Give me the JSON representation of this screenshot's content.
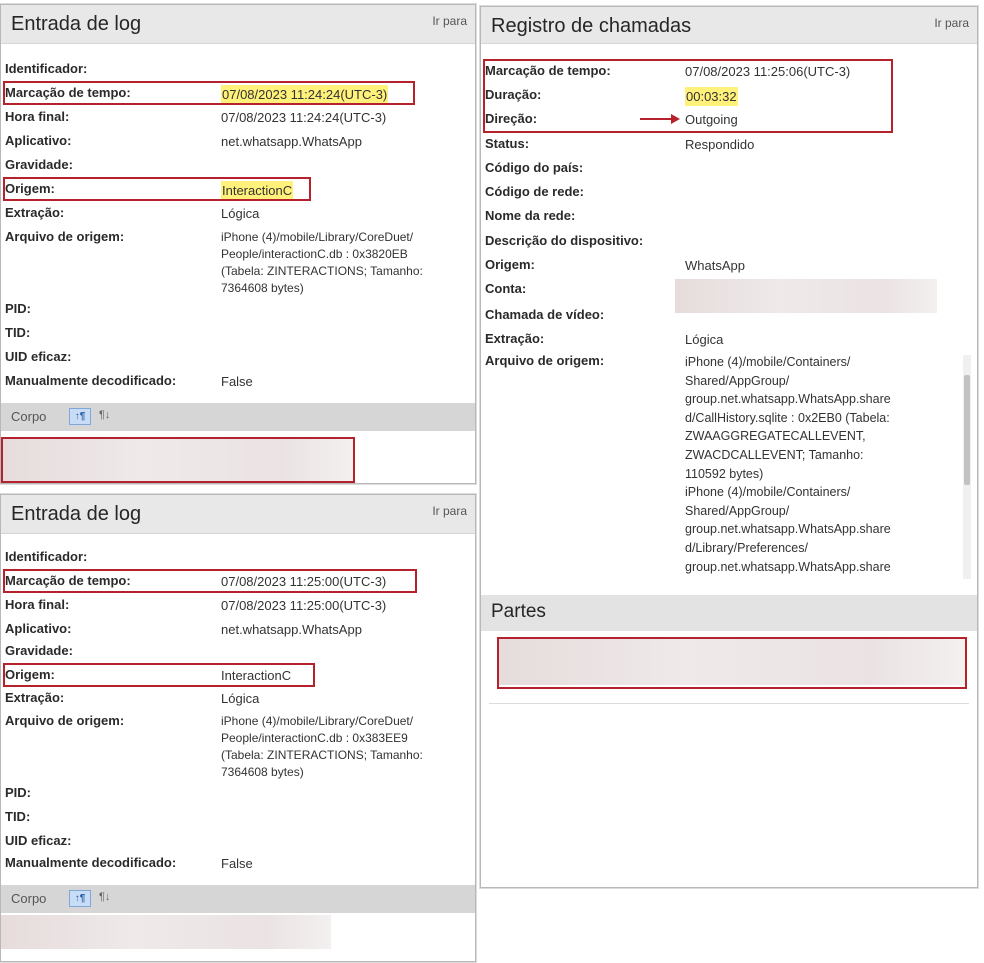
{
  "log1": {
    "title": "Entrada de log",
    "goto": "Ir para",
    "fields": {
      "identificador": {
        "label": "Identificador:",
        "value": ""
      },
      "marcacao": {
        "label": "Marcação de tempo:",
        "value": "07/08/2023 11:24:24(UTC-3)"
      },
      "hora_final": {
        "label": "Hora final:",
        "value": "07/08/2023 11:24:24(UTC-3)"
      },
      "aplicativo": {
        "label": "Aplicativo:",
        "value": "net.whatsapp.WhatsApp"
      },
      "gravidade": {
        "label": "Gravidade:",
        "value": ""
      },
      "origem": {
        "label": "Origem:",
        "value": "InteractionC"
      },
      "extracao": {
        "label": "Extração:",
        "value": "Lógica"
      },
      "arquivo": {
        "label": "Arquivo de origem:",
        "value_lines": [
          "iPhone (4)/mobile/Library/CoreDuet/",
          "People/interactionC.db : 0x3820EB",
          "(Tabela: ZINTERACTIONS; Tamanho:",
          "7364608 bytes)"
        ]
      },
      "pid": {
        "label": "PID:",
        "value": ""
      },
      "tid": {
        "label": "TID:",
        "value": ""
      },
      "uid": {
        "label": "UID eficaz:",
        "value": ""
      },
      "manual": {
        "label": "Manualmente decodificado:",
        "value": "False"
      }
    },
    "toolbar": {
      "corpo": "Corpo",
      "btn1": "↑¶",
      "btn2": "¶↓"
    }
  },
  "log2": {
    "title": "Entrada de log",
    "goto": "Ir para",
    "fields": {
      "identificador": {
        "label": "Identificador:",
        "value": ""
      },
      "marcacao": {
        "label": "Marcação de tempo:",
        "value": "07/08/2023 11:25:00(UTC-3)"
      },
      "hora_final": {
        "label": "Hora final:",
        "value": "07/08/2023 11:25:00(UTC-3)"
      },
      "aplicativo": {
        "label": "Aplicativo:",
        "value": "net.whatsapp.WhatsApp"
      },
      "gravidade": {
        "label": "Gravidade:",
        "value": ""
      },
      "origem": {
        "label": "Origem:",
        "value": "InteractionC"
      },
      "extracao": {
        "label": "Extração:",
        "value": "Lógica"
      },
      "arquivo": {
        "label": "Arquivo de origem:",
        "value_lines": [
          "iPhone (4)/mobile/Library/CoreDuet/",
          "People/interactionC.db : 0x383EE9",
          "(Tabela: ZINTERACTIONS; Tamanho:",
          "7364608 bytes)"
        ]
      },
      "pid": {
        "label": "PID:",
        "value": ""
      },
      "tid": {
        "label": "TID:",
        "value": ""
      },
      "uid": {
        "label": "UID eficaz:",
        "value": ""
      },
      "manual": {
        "label": "Manualmente decodificado:",
        "value": "False"
      }
    },
    "toolbar": {
      "corpo": "Corpo",
      "btn1": "↑¶",
      "btn2": "¶↓"
    }
  },
  "calls": {
    "title": "Registro de chamadas",
    "goto": "Ir para",
    "fields": {
      "marcacao": {
        "label": "Marcação de tempo:",
        "value": "07/08/2023 11:25:06(UTC-3)"
      },
      "duracao": {
        "label": "Duração:",
        "value": "00:03:32"
      },
      "direcao": {
        "label": "Direção:",
        "value": "Outgoing"
      },
      "status": {
        "label": "Status:",
        "value": "Respondido"
      },
      "codigo_pais": {
        "label": "Código do país:",
        "value": ""
      },
      "codigo_rede": {
        "label": "Código de rede:",
        "value": ""
      },
      "nome_rede": {
        "label": "Nome da rede:",
        "value": ""
      },
      "descricao": {
        "label": "Descrição do dispositivo:",
        "value": ""
      },
      "origem": {
        "label": "Origem:",
        "value": "WhatsApp"
      },
      "conta": {
        "label": "Conta:",
        "value": ""
      },
      "video": {
        "label": "Chamada de vídeo:",
        "value": ""
      },
      "extracao": {
        "label": "Extração:",
        "value": "Lógica"
      },
      "arquivo": {
        "label": "Arquivo de origem:",
        "value_lines": [
          "iPhone (4)/mobile/Containers/",
          "Shared/AppGroup/",
          "group.net.whatsapp.WhatsApp.share",
          "d/CallHistory.sqlite : 0x2EB0 (Tabela:",
          "ZWAAGGREGATECALLEVENT,",
          "ZWACDCALLEVENT; Tamanho:",
          "110592 bytes)",
          "iPhone (4)/mobile/Containers/",
          "Shared/AppGroup/",
          "group.net.whatsapp.WhatsApp.share",
          "d/Library/Preferences/",
          "group.net.whatsapp.WhatsApp.share"
        ]
      }
    },
    "partes_title": "Partes"
  },
  "colors": {
    "highlight": "#fff17a",
    "annotation_red": "#b5222b",
    "header_gray": "#e8e8e8"
  }
}
